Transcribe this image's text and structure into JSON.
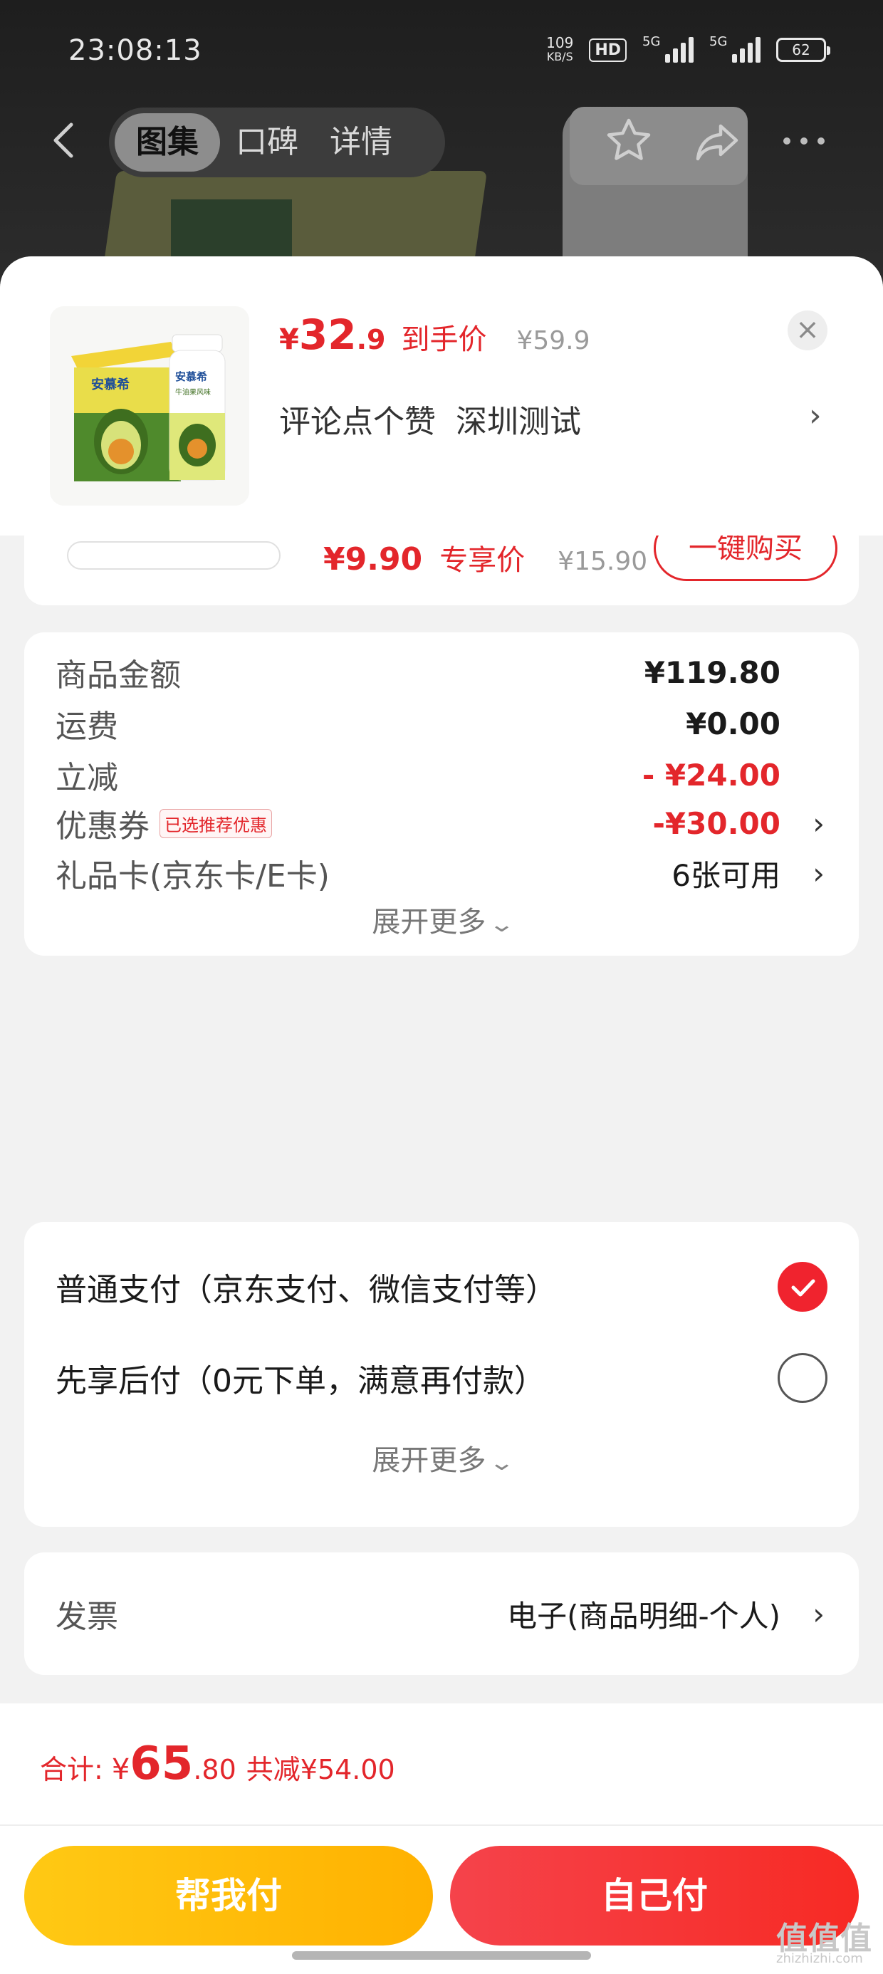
{
  "status_bar": {
    "time": "23:08:13",
    "net_speed_value": "109",
    "net_speed_unit": "KB/S",
    "hd_label": "HD",
    "signal_1": "5G",
    "signal_2": "5G",
    "battery": "62"
  },
  "nav": {
    "tabs": [
      {
        "label": "图集",
        "active": true
      },
      {
        "label": "口碑",
        "active": false
      },
      {
        "label": "详情",
        "active": false
      }
    ]
  },
  "product": {
    "currency": "¥",
    "price_int": "32",
    "price_dec": ".9",
    "price_tag": "到手价",
    "original_price": "¥59.9",
    "comment_prompt": "评论点个赞",
    "comment_location": "深圳测试",
    "close_label": "×",
    "image_brand": "安慕希",
    "image_brand_2": "安慕希",
    "image_subtitle": "牛油果风味"
  },
  "peek_item": {
    "price": "¥9.90",
    "tag": "专享价",
    "original_price": "¥15.90",
    "button": "一键购买"
  },
  "amounts": {
    "rows": [
      {
        "label": "商品金额",
        "value": "¥119.80"
      },
      {
        "label": "运费",
        "value": "¥0.00"
      },
      {
        "label": "立减",
        "value": "- ¥24.00"
      },
      {
        "label": "优惠券",
        "badge": "已选推荐优惠",
        "value": "-¥30.00"
      },
      {
        "label": "礼品卡(京东卡/E卡)",
        "value": "6张可用"
      }
    ],
    "expand_label": "展开更多"
  },
  "payment": {
    "options": [
      {
        "label": "普通支付（京东支付、微信支付等）",
        "checked": true
      },
      {
        "label": "先享后付（0元下单，满意再付款）",
        "checked": false
      }
    ],
    "expand_label": "展开更多"
  },
  "invoice": {
    "label": "发票",
    "value": "电子(商品明细-个人)"
  },
  "footer": {
    "total_label": "合计:",
    "currency": "¥",
    "total_int": "65",
    "total_dec": ".80",
    "savings": "共减¥54.00",
    "help_pay_button": "帮我付",
    "self_pay_button": "自己付"
  },
  "watermark": {
    "main": "值值值",
    "sub": "zhizhizhi.com"
  },
  "colors": {
    "accent_red": "#e3262b",
    "help_button": "#ffb100",
    "self_button": "#f72a24"
  }
}
